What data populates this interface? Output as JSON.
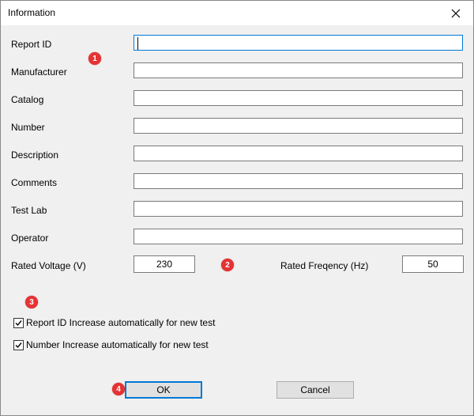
{
  "window": {
    "title": "Information"
  },
  "fields": [
    {
      "label": "Report ID",
      "value": ""
    },
    {
      "label": "Manufacturer",
      "value": ""
    },
    {
      "label": "Catalog",
      "value": ""
    },
    {
      "label": "Number",
      "value": ""
    },
    {
      "label": "Description",
      "value": ""
    },
    {
      "label": "Comments",
      "value": ""
    },
    {
      "label": "Test Lab",
      "value": ""
    },
    {
      "label": "Operator",
      "value": ""
    }
  ],
  "rated": {
    "voltage_label": "Rated Voltage (V)",
    "voltage_value": "230",
    "frequency_label": "Rated Freqency (Hz)",
    "frequency_value": "50"
  },
  "checkboxes": [
    {
      "label": "Report ID Increase automatically for new test",
      "checked": true
    },
    {
      "label": "Number Increase automatically for new test",
      "checked": true
    }
  ],
  "buttons": {
    "ok": "OK",
    "cancel": "Cancel"
  },
  "badges": [
    "1",
    "2",
    "3",
    "4"
  ],
  "colors": {
    "badge": "#e63233",
    "focus": "#0078d7"
  }
}
